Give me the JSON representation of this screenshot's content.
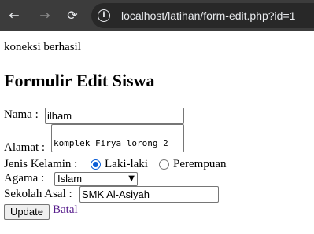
{
  "browser": {
    "back_icon": "←",
    "forward_icon": "→",
    "reload_icon": "⟳",
    "url": "localhost/latihan/form-edit.php?id=1"
  },
  "page": {
    "status_text": "koneksi berhasil",
    "title": "Formulir Edit Siswa"
  },
  "form": {
    "nama_label": "Nama :",
    "nama_value": "ilham",
    "alamat_label": "Alamat :",
    "alamat_value": "komplek Firya lorong 2",
    "jk_label": "Jenis Kelamin :",
    "jk_options": [
      "Laki-laki",
      "Perempuan"
    ],
    "jk_selected": "Laki-laki",
    "agama_label": "Agama :",
    "agama_value": "Islam",
    "sekolah_label": "Sekolah Asal :",
    "sekolah_value": "SMK Al-Asiyah",
    "update_label": "Update",
    "batal_label": "Batal"
  }
}
